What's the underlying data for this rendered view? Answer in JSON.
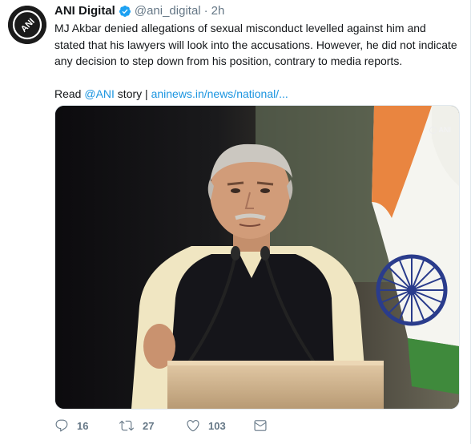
{
  "tweet": {
    "author_name": "ANI Digital",
    "handle": "@ani_digital",
    "separator": "·",
    "timestamp": "2h",
    "avatar_text": "ANI",
    "text": "MJ Akbar denied allegations of sexual misconduct levelled against him and stated that his lawyers will look into the accusations. However, he did not indicate any decision to step down from his position, contrary to media reports.",
    "read_prefix": "Read ",
    "mention": "@ANI",
    "read_suffix": " story | ",
    "link_text": "aninews.in/news/national/...",
    "media": {
      "watermark": "ANI"
    }
  },
  "actions": {
    "reply_count": "16",
    "retweet_count": "27",
    "like_count": "103"
  },
  "colors": {
    "link": "#1b95e0",
    "muted": "#657786",
    "verified": "#1da1f2"
  },
  "icons": [
    "verified-badge-icon",
    "reply-icon",
    "retweet-icon",
    "like-icon",
    "message-icon"
  ]
}
